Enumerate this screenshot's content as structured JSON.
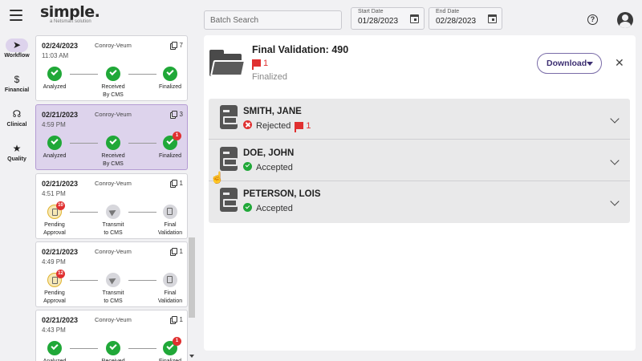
{
  "app": {
    "logo_text": "simple.",
    "logo_tagline": "a Netsmart solution"
  },
  "header": {
    "batch_search_placeholder": "Batch Search",
    "start_date_label": "Start Date",
    "start_date_value": "01/28/2023",
    "end_date_label": "End Date",
    "end_date_value": "02/28/2023",
    "help_icon": "?"
  },
  "nav": {
    "items": [
      {
        "label": "Workflow",
        "icon": "paper-plane-icon",
        "glyph": "➤"
      },
      {
        "label": "Financial",
        "icon": "dollar-icon",
        "glyph": "$"
      },
      {
        "label": "Clinical",
        "icon": "stethoscope-icon",
        "glyph": "☊"
      },
      {
        "label": "Quality",
        "icon": "star-icon",
        "glyph": "★"
      }
    ]
  },
  "batches": [
    {
      "date": "02/24/2023",
      "time": "11:03 AM",
      "payer": "Conroy-Veum",
      "count": "7",
      "selected": false,
      "steps": [
        {
          "label1": "Analyzed",
          "label2": "",
          "state": "done",
          "badge": ""
        },
        {
          "label1": "Received",
          "label2": "By CMS",
          "state": "done",
          "badge": ""
        },
        {
          "label1": "Finalized",
          "label2": "",
          "state": "done",
          "badge": ""
        }
      ]
    },
    {
      "date": "02/21/2023",
      "time": "4:59 PM",
      "payer": "Conroy-Veum",
      "count": "3",
      "selected": true,
      "steps": [
        {
          "label1": "Analyzed",
          "label2": "",
          "state": "done",
          "badge": ""
        },
        {
          "label1": "Received",
          "label2": "By CMS",
          "state": "done",
          "badge": ""
        },
        {
          "label1": "Finalized",
          "label2": "",
          "state": "done",
          "badge": "1"
        }
      ]
    },
    {
      "date": "02/21/2023",
      "time": "4:51 PM",
      "payer": "Conroy-Veum",
      "count": "1",
      "selected": false,
      "steps": [
        {
          "label1": "Pending",
          "label2": "Approval",
          "state": "warn",
          "badge": "10"
        },
        {
          "label1": "Transmit",
          "label2": "to CMS",
          "state": "pending-plane",
          "badge": ""
        },
        {
          "label1": "Final",
          "label2": "Validation",
          "state": "pending-doc",
          "badge": ""
        }
      ]
    },
    {
      "date": "02/21/2023",
      "time": "4:49 PM",
      "payer": "Conroy-Veum",
      "count": "1",
      "selected": false,
      "steps": [
        {
          "label1": "Pending",
          "label2": "Approval",
          "state": "warn",
          "badge": "12"
        },
        {
          "label1": "Transmit",
          "label2": "to CMS",
          "state": "pending-plane",
          "badge": ""
        },
        {
          "label1": "Final",
          "label2": "Validation",
          "state": "pending-doc",
          "badge": ""
        }
      ]
    },
    {
      "date": "02/21/2023",
      "time": "4:43 PM",
      "payer": "Conroy-Veum",
      "count": "1",
      "selected": false,
      "steps": [
        {
          "label1": "Analyzed",
          "label2": "",
          "state": "done",
          "badge": ""
        },
        {
          "label1": "Received",
          "label2": "",
          "state": "done",
          "badge": ""
        },
        {
          "label1": "Finalized",
          "label2": "",
          "state": "done",
          "badge": "1"
        }
      ]
    }
  ],
  "detail": {
    "title": "Final Validation: 490",
    "flag_count": "1",
    "status": "Finalized",
    "download_label": "Download",
    "close_glyph": "✕",
    "claims": [
      {
        "name": "SMITH, JANE",
        "status": "Rejected",
        "status_type": "bad",
        "flag_count": "1"
      },
      {
        "name": "DOE, JOHN",
        "status": "Accepted",
        "status_type": "ok",
        "flag_count": ""
      },
      {
        "name": "PETERSON, LOIS",
        "status": "Accepted",
        "status_type": "ok",
        "flag_count": ""
      }
    ]
  },
  "colors": {
    "accent_purple": "#ddd3ec",
    "success_green": "#20a838",
    "error_red": "#e03030",
    "pending_yellow": "#f6e8b5"
  }
}
